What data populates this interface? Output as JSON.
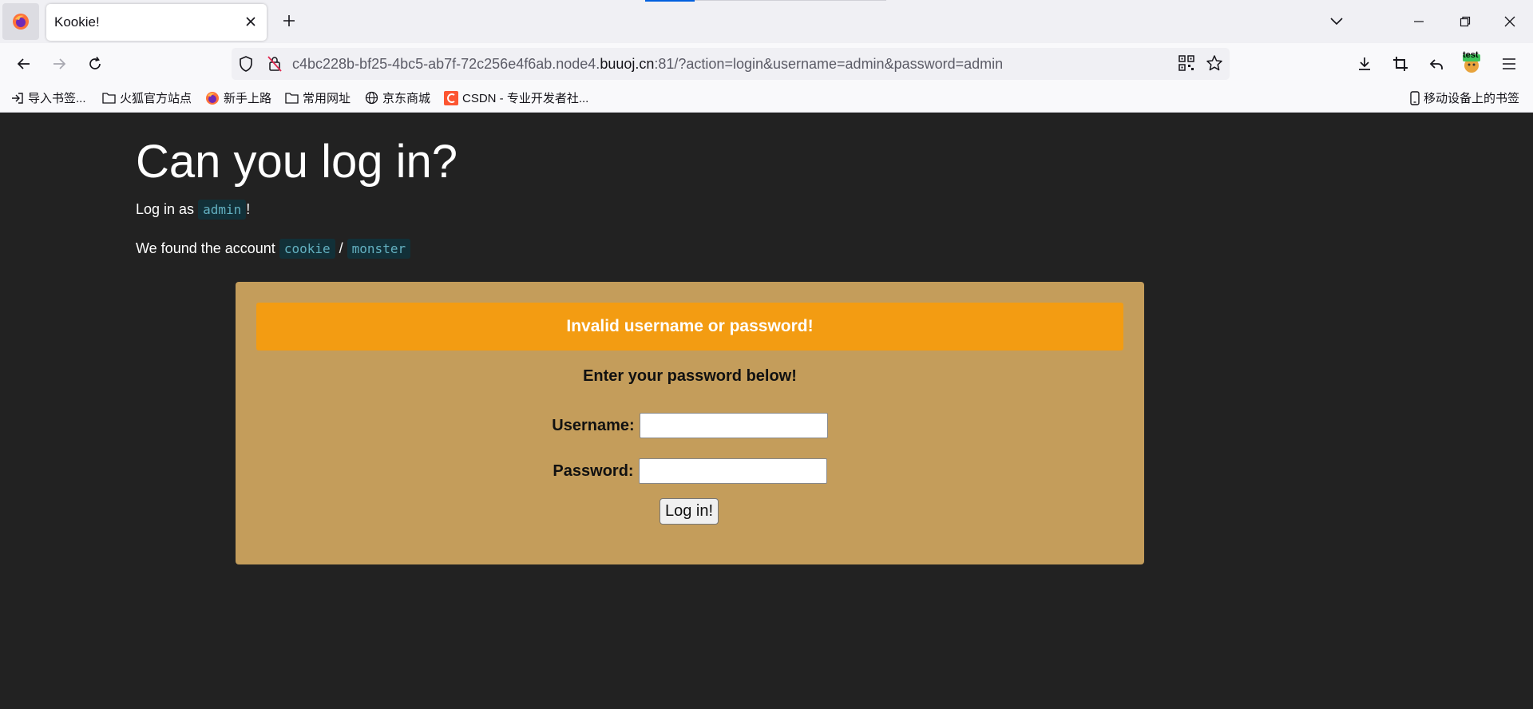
{
  "browser": {
    "tab_title": "Kookie!",
    "url_prefix": "c4bc228b-bf25-4bc5-ab7f-72c256e4f6ab.node4.",
    "url_domain": "buuoj.cn",
    "url_suffix": ":81/?action=login&username=admin&password=admin",
    "extension_label": "test",
    "bookmarks": [
      {
        "label": "导入书签...",
        "icon": "import-icon"
      },
      {
        "label": "火狐官方站点",
        "icon": "folder-icon"
      },
      {
        "label": "新手上路",
        "icon": "firefox-icon"
      },
      {
        "label": "常用网址",
        "icon": "folder-icon"
      },
      {
        "label": "京东商城",
        "icon": "globe-icon"
      },
      {
        "label": "CSDN - 专业开发者社...",
        "icon": "csdn-icon"
      }
    ],
    "mobile_bookmarks": "移动设备上的书签"
  },
  "page": {
    "title": "Can you log in?",
    "login_prefix": "Log in as",
    "login_user": "admin",
    "login_suffix": "!",
    "found_prefix": "We found the account",
    "found_user": "cookie",
    "found_sep": "/",
    "found_pass": "monster",
    "alert": "Invalid username or password!",
    "prompt": "Enter your password below!",
    "username_label": "Username:",
    "password_label": "Password:",
    "username_value": "",
    "password_value": "",
    "submit_label": "Log in!"
  },
  "colors": {
    "page_bg": "#222222",
    "card_bg": "#c49d5b",
    "alert_bg": "#f39c12",
    "code_fg": "#63b0c0",
    "code_bg": "#123038"
  }
}
